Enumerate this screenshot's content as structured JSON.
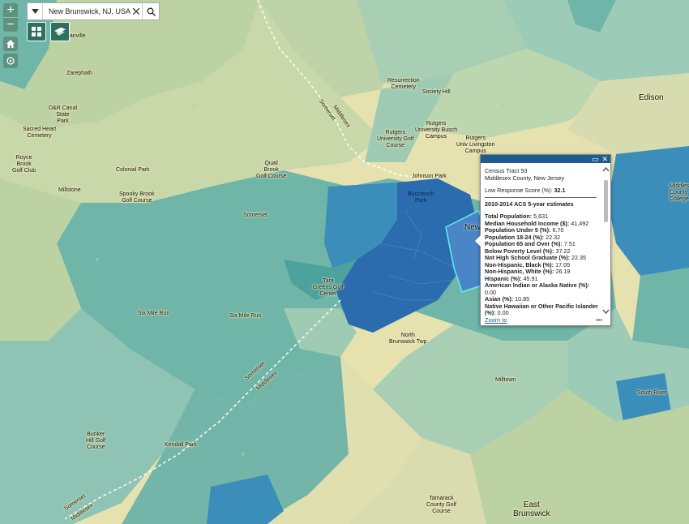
{
  "search": {
    "value": "New Brunswick, NJ, USA"
  },
  "controls": {
    "zoom_in": "+",
    "zoom_out": "−"
  },
  "labels": {
    "manville": "Manville",
    "zarephath": "Zarephath",
    "dr_canal_park": "D&R Canal\nState\nPark",
    "sacred_heart": "Sacred Heart\nCemetery",
    "royce_brook": "Royce\nBrook\nGolf Club",
    "colonial_park": "Colonial Park",
    "millstone": "Millstone",
    "spooky_brook": "Spooky Brook\nGolf Course",
    "quail_brook": "Quail\nBrook\nGolf Course",
    "somerset": "Somerset",
    "johnson_park": "Johnson Park",
    "buccleuch": "Buccleuch\nPark",
    "resurrection": "Resurrection\nCemetery",
    "society_hill": "Society Hill",
    "rutgers_busch": "Rutgers\nUniversity Busch\nCampus",
    "rutgers_golf": "Rutgers\nUniversity Golf\nCourse",
    "rutgers_livingston": "Rutgers\nUniv Livingston\nCampus",
    "edison": "Edison",
    "middlesex_college": "Middlesex\nCounty\nCollege",
    "new_brunswick": "New",
    "tara_greens": "Tara\nGreens Golf\nCenter",
    "six_mile_run_1": "Six Mile Run",
    "six_mile_run_2": "Six Mile Run",
    "north_brunswick": "North\nBrunswick Twp",
    "milltown": "Milltown",
    "south_river": "South River",
    "bunker_hill": "Bunker\nHill Golf\nCourse",
    "kendall_park": "Kendall Park",
    "tamarack": "Tamarack\nCounty Golf\nCourse",
    "east_brunswick": "East\nBrunswick",
    "somerset_line_top": "Somerset",
    "middlesex_line_top": "Middlesex",
    "somerset_line_mid": "Somerset",
    "middlesex_line_mid": "Middlesex",
    "somerset_line_bot": "Somerset",
    "middlesex_line_bot": "Middlesex"
  },
  "popup": {
    "title": "Census Tract 93",
    "county": "Middlesex County, New Jersey",
    "lrs_label": "Low Response Score (%):",
    "lrs_value": "32.1",
    "acs_heading": "2010-2014 ACS 5-year estimates",
    "fields": [
      {
        "label": "Total Population:",
        "value": "5,631"
      },
      {
        "label": "Median Household Income ($):",
        "value": "41,492"
      },
      {
        "label": "Population Under 5 (%):",
        "value": "6.70"
      },
      {
        "label": "Population 18-24 (%):",
        "value": "22.32"
      },
      {
        "label": "Population 65 and Over (%):",
        "value": "7.51"
      },
      {
        "label": "Below Poverty Level (%):",
        "value": "37.22"
      },
      {
        "label": "Not High School Graduate (%):",
        "value": "22.35"
      },
      {
        "label": "Non-Hispanic, Black (%):",
        "value": "17.05"
      },
      {
        "label": "Non-Hispanic, White (%):",
        "value": "26.19"
      },
      {
        "label": "Hispanic (%):",
        "value": "45.91"
      },
      {
        "label": "American Indian or Alaska Native (%):",
        "value": "0.00"
      },
      {
        "label": "Asian (%):",
        "value": "10.85"
      },
      {
        "label": "Native Hawaiian or Other Pacific Islander (%):",
        "value": "0.00"
      }
    ],
    "zoom_to": "Zoom to",
    "more": "•••",
    "maximize": "▭",
    "close": "✕"
  },
  "colors": {
    "light": "#e6e2b0",
    "pale_green": "#bfd3a8",
    "teal_light": "#9ccbb8",
    "teal_mid": "#6fb5a8",
    "teal": "#4da29e",
    "blue_mid": "#3b8dba",
    "blue_dark": "#2a6cad",
    "accent": "#1f5b8c"
  }
}
